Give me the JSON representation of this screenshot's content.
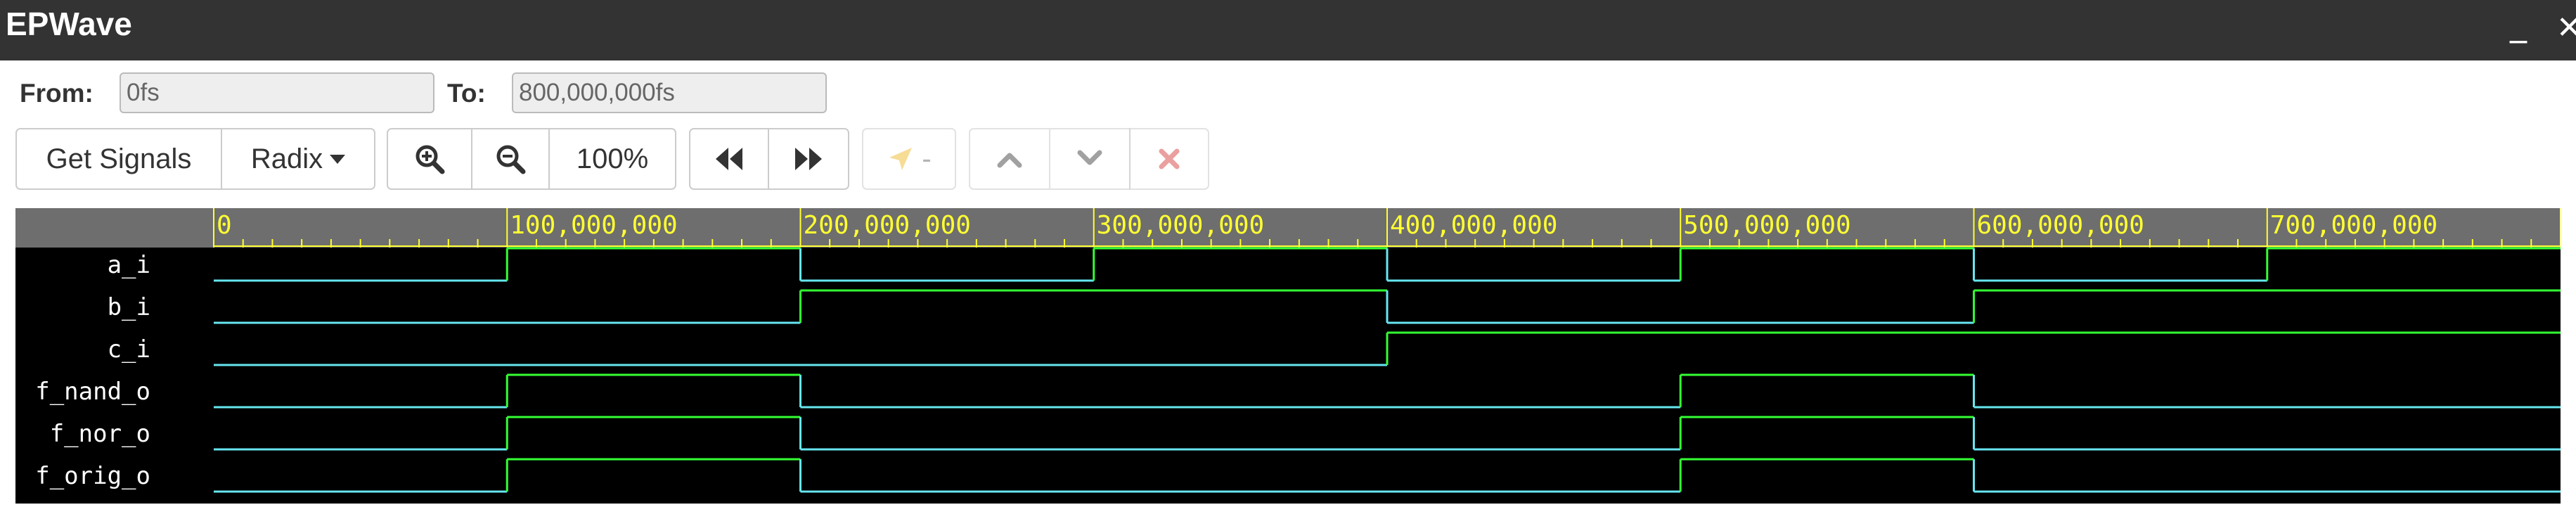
{
  "app": {
    "title": "EPWave",
    "minimize_glyph": "_",
    "close_glyph": "✕"
  },
  "range": {
    "from_label": "From:",
    "from_value": "0fs",
    "to_label": "To:",
    "to_value": "800,000,000fs"
  },
  "toolbar": {
    "get_signals_label": "Get Signals",
    "radix_label": "Radix",
    "zoom_in_icon": "zoom-in-icon",
    "zoom_out_icon": "zoom-out-icon",
    "zoom_level": "100%",
    "rewind_icon": "rewind-icon",
    "fast_forward_icon": "fast-forward-icon",
    "cursor_label": "-",
    "cursor_icon": "cursor-arrow-icon",
    "move_up_icon": "chevron-up-icon",
    "move_down_icon": "chevron-down-icon",
    "delete_icon": "close-icon"
  },
  "colors": {
    "title_bar": "#333333",
    "wave_background": "#000000",
    "ruler_background": "#6e6e6e",
    "ruler_text": "#ffff33",
    "wave_low": "#66e6f0",
    "wave_high": "#33ff33",
    "delete_icon": "#d9534f",
    "cursor_icon": "#f0c040"
  },
  "timeline": {
    "start": 0,
    "end": 800000000,
    "unit": "fs",
    "tick_labels": [
      "0",
      "100,000,000",
      "200,000,000",
      "300,000,000",
      "400,000,000",
      "500,000,000",
      "600,000,000",
      "700,000,000"
    ]
  },
  "signals": [
    {
      "name": "a_i",
      "transitions": [
        [
          0,
          0
        ],
        [
          100000000,
          1
        ],
        [
          200000000,
          0
        ],
        [
          300000000,
          1
        ],
        [
          400000000,
          0
        ],
        [
          500000000,
          1
        ],
        [
          600000000,
          0
        ],
        [
          700000000,
          1
        ]
      ]
    },
    {
      "name": "b_i",
      "transitions": [
        [
          0,
          0
        ],
        [
          200000000,
          1
        ],
        [
          400000000,
          0
        ],
        [
          600000000,
          1
        ]
      ]
    },
    {
      "name": "c_i",
      "transitions": [
        [
          0,
          0
        ],
        [
          400000000,
          1
        ]
      ]
    },
    {
      "name": "f_nand_o",
      "transitions": [
        [
          0,
          0
        ],
        [
          100000000,
          1
        ],
        [
          200000000,
          0
        ],
        [
          500000000,
          1
        ],
        [
          600000000,
          0
        ]
      ]
    },
    {
      "name": "f_nor_o",
      "transitions": [
        [
          0,
          0
        ],
        [
          100000000,
          1
        ],
        [
          200000000,
          0
        ],
        [
          500000000,
          1
        ],
        [
          600000000,
          0
        ]
      ]
    },
    {
      "name": "f_orig_o",
      "transitions": [
        [
          0,
          0
        ],
        [
          100000000,
          1
        ],
        [
          200000000,
          0
        ],
        [
          500000000,
          1
        ],
        [
          600000000,
          0
        ]
      ]
    }
  ]
}
